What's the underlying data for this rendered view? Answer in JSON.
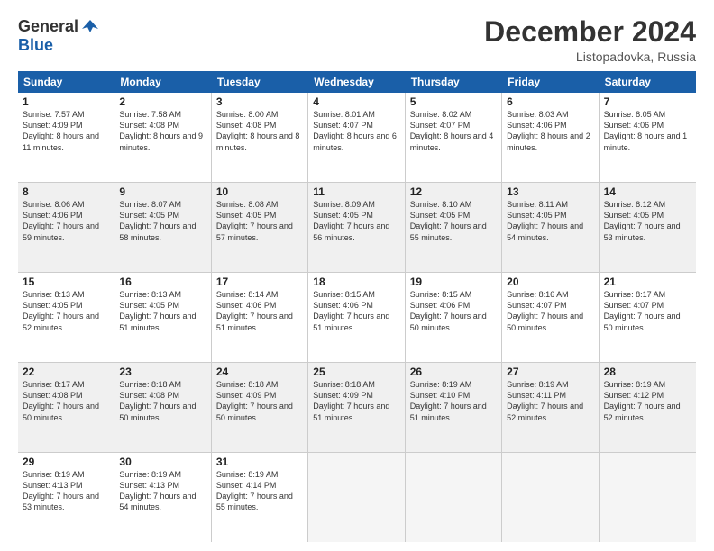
{
  "logo": {
    "general": "General",
    "blue": "Blue"
  },
  "title": "December 2024",
  "location": "Listopadovka, Russia",
  "header_days": [
    "Sunday",
    "Monday",
    "Tuesday",
    "Wednesday",
    "Thursday",
    "Friday",
    "Saturday"
  ],
  "weeks": [
    [
      {
        "day": "1",
        "sunrise": "7:57 AM",
        "sunset": "4:09 PM",
        "daylight": "8 hours and 11 minutes.",
        "shaded": false
      },
      {
        "day": "2",
        "sunrise": "7:58 AM",
        "sunset": "4:08 PM",
        "daylight": "8 hours and 9 minutes.",
        "shaded": false
      },
      {
        "day": "3",
        "sunrise": "8:00 AM",
        "sunset": "4:08 PM",
        "daylight": "8 hours and 8 minutes.",
        "shaded": false
      },
      {
        "day": "4",
        "sunrise": "8:01 AM",
        "sunset": "4:07 PM",
        "daylight": "8 hours and 6 minutes.",
        "shaded": false
      },
      {
        "day": "5",
        "sunrise": "8:02 AM",
        "sunset": "4:07 PM",
        "daylight": "8 hours and 4 minutes.",
        "shaded": false
      },
      {
        "day": "6",
        "sunrise": "8:03 AM",
        "sunset": "4:06 PM",
        "daylight": "8 hours and 2 minutes.",
        "shaded": false
      },
      {
        "day": "7",
        "sunrise": "8:05 AM",
        "sunset": "4:06 PM",
        "daylight": "8 hours and 1 minute.",
        "shaded": false
      }
    ],
    [
      {
        "day": "8",
        "sunrise": "8:06 AM",
        "sunset": "4:06 PM",
        "daylight": "7 hours and 59 minutes.",
        "shaded": true
      },
      {
        "day": "9",
        "sunrise": "8:07 AM",
        "sunset": "4:05 PM",
        "daylight": "7 hours and 58 minutes.",
        "shaded": true
      },
      {
        "day": "10",
        "sunrise": "8:08 AM",
        "sunset": "4:05 PM",
        "daylight": "7 hours and 57 minutes.",
        "shaded": true
      },
      {
        "day": "11",
        "sunrise": "8:09 AM",
        "sunset": "4:05 PM",
        "daylight": "7 hours and 56 minutes.",
        "shaded": true
      },
      {
        "day": "12",
        "sunrise": "8:10 AM",
        "sunset": "4:05 PM",
        "daylight": "7 hours and 55 minutes.",
        "shaded": true
      },
      {
        "day": "13",
        "sunrise": "8:11 AM",
        "sunset": "4:05 PM",
        "daylight": "7 hours and 54 minutes.",
        "shaded": true
      },
      {
        "day": "14",
        "sunrise": "8:12 AM",
        "sunset": "4:05 PM",
        "daylight": "7 hours and 53 minutes.",
        "shaded": true
      }
    ],
    [
      {
        "day": "15",
        "sunrise": "8:13 AM",
        "sunset": "4:05 PM",
        "daylight": "7 hours and 52 minutes.",
        "shaded": false
      },
      {
        "day": "16",
        "sunrise": "8:13 AM",
        "sunset": "4:05 PM",
        "daylight": "7 hours and 51 minutes.",
        "shaded": false
      },
      {
        "day": "17",
        "sunrise": "8:14 AM",
        "sunset": "4:06 PM",
        "daylight": "7 hours and 51 minutes.",
        "shaded": false
      },
      {
        "day": "18",
        "sunrise": "8:15 AM",
        "sunset": "4:06 PM",
        "daylight": "7 hours and 51 minutes.",
        "shaded": false
      },
      {
        "day": "19",
        "sunrise": "8:15 AM",
        "sunset": "4:06 PM",
        "daylight": "7 hours and 50 minutes.",
        "shaded": false
      },
      {
        "day": "20",
        "sunrise": "8:16 AM",
        "sunset": "4:07 PM",
        "daylight": "7 hours and 50 minutes.",
        "shaded": false
      },
      {
        "day": "21",
        "sunrise": "8:17 AM",
        "sunset": "4:07 PM",
        "daylight": "7 hours and 50 minutes.",
        "shaded": false
      }
    ],
    [
      {
        "day": "22",
        "sunrise": "8:17 AM",
        "sunset": "4:08 PM",
        "daylight": "7 hours and 50 minutes.",
        "shaded": true
      },
      {
        "day": "23",
        "sunrise": "8:18 AM",
        "sunset": "4:08 PM",
        "daylight": "7 hours and 50 minutes.",
        "shaded": true
      },
      {
        "day": "24",
        "sunrise": "8:18 AM",
        "sunset": "4:09 PM",
        "daylight": "7 hours and 50 minutes.",
        "shaded": true
      },
      {
        "day": "25",
        "sunrise": "8:18 AM",
        "sunset": "4:09 PM",
        "daylight": "7 hours and 51 minutes.",
        "shaded": true
      },
      {
        "day": "26",
        "sunrise": "8:19 AM",
        "sunset": "4:10 PM",
        "daylight": "7 hours and 51 minutes.",
        "shaded": true
      },
      {
        "day": "27",
        "sunrise": "8:19 AM",
        "sunset": "4:11 PM",
        "daylight": "7 hours and 52 minutes.",
        "shaded": true
      },
      {
        "day": "28",
        "sunrise": "8:19 AM",
        "sunset": "4:12 PM",
        "daylight": "7 hours and 52 minutes.",
        "shaded": true
      }
    ],
    [
      {
        "day": "29",
        "sunrise": "8:19 AM",
        "sunset": "4:13 PM",
        "daylight": "7 hours and 53 minutes.",
        "shaded": false
      },
      {
        "day": "30",
        "sunrise": "8:19 AM",
        "sunset": "4:13 PM",
        "daylight": "7 hours and 54 minutes.",
        "shaded": false
      },
      {
        "day": "31",
        "sunrise": "8:19 AM",
        "sunset": "4:14 PM",
        "daylight": "7 hours and 55 minutes.",
        "shaded": false
      },
      {
        "day": "",
        "sunrise": "",
        "sunset": "",
        "daylight": "",
        "shaded": false,
        "empty": true
      },
      {
        "day": "",
        "sunrise": "",
        "sunset": "",
        "daylight": "",
        "shaded": false,
        "empty": true
      },
      {
        "day": "",
        "sunrise": "",
        "sunset": "",
        "daylight": "",
        "shaded": false,
        "empty": true
      },
      {
        "day": "",
        "sunrise": "",
        "sunset": "",
        "daylight": "",
        "shaded": false,
        "empty": true
      }
    ]
  ]
}
